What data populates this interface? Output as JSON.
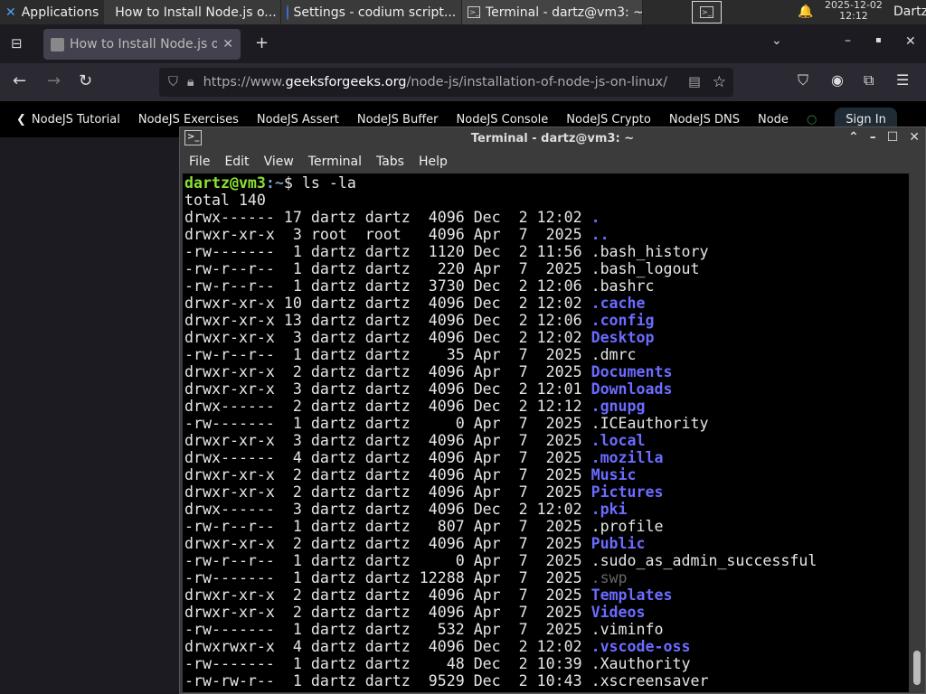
{
  "taskbar": {
    "apps": "Applications",
    "tasks": [
      "How to Install Node.js o...",
      "Settings - codium script...",
      "Terminal - dartz@vm3: ~"
    ],
    "date": "2025-12-02",
    "time": "12:12",
    "user": "Dartz"
  },
  "browser": {
    "tab_title": "How to Install Node.js or",
    "url_prefix": "https://www.",
    "url_domain": "geeksforgeeks.org",
    "url_path": "/node-js/installation-of-node-js-on-linux/",
    "bookmarks": [
      "NodeJS Tutorial",
      "NodeJS Exercises",
      "NodeJS Assert",
      "NodeJS Buffer",
      "NodeJS Console",
      "NodeJS Crypto",
      "NodeJS DNS",
      "Node"
    ],
    "signin": "Sign In"
  },
  "terminal": {
    "title": "Terminal - dartz@vm3: ~",
    "menu": [
      "File",
      "Edit",
      "View",
      "Terminal",
      "Tabs",
      "Help"
    ],
    "prompt_user": "dartz@vm3",
    "prompt_path": ":~",
    "command": "$ ls -la",
    "total": "total 140",
    "rows": [
      [
        "drwx------ 17 dartz dartz  4096 Dec  2 12:02 ",
        ".",
        "dir"
      ],
      [
        "drwxr-xr-x  3 root  root   4096 Apr  7  2025 ",
        "..",
        "dir"
      ],
      [
        "-rw-------  1 dartz dartz  1120 Dec  2 11:56 ",
        ".bash_history",
        ""
      ],
      [
        "-rw-r--r--  1 dartz dartz   220 Apr  7  2025 ",
        ".bash_logout",
        ""
      ],
      [
        "-rw-r--r--  1 dartz dartz  3730 Dec  2 12:06 ",
        ".bashrc",
        ""
      ],
      [
        "drwxr-xr-x 10 dartz dartz  4096 Dec  2 12:02 ",
        ".cache",
        "dir"
      ],
      [
        "drwxr-xr-x 13 dartz dartz  4096 Dec  2 12:06 ",
        ".config",
        "dir"
      ],
      [
        "drwxr-xr-x  3 dartz dartz  4096 Dec  2 12:02 ",
        "Desktop",
        "dir"
      ],
      [
        "-rw-r--r--  1 dartz dartz    35 Apr  7  2025 ",
        ".dmrc",
        ""
      ],
      [
        "drwxr-xr-x  2 dartz dartz  4096 Apr  7  2025 ",
        "Documents",
        "dir"
      ],
      [
        "drwxr-xr-x  3 dartz dartz  4096 Dec  2 12:01 ",
        "Downloads",
        "dir"
      ],
      [
        "drwx------  2 dartz dartz  4096 Dec  2 12:12 ",
        ".gnupg",
        "dir"
      ],
      [
        "-rw-------  1 dartz dartz     0 Apr  7  2025 ",
        ".ICEauthority",
        ""
      ],
      [
        "drwxr-xr-x  3 dartz dartz  4096 Apr  7  2025 ",
        ".local",
        "dir"
      ],
      [
        "drwx------  4 dartz dartz  4096 Apr  7  2025 ",
        ".mozilla",
        "dir"
      ],
      [
        "drwxr-xr-x  2 dartz dartz  4096 Apr  7  2025 ",
        "Music",
        "dir"
      ],
      [
        "drwxr-xr-x  2 dartz dartz  4096 Apr  7  2025 ",
        "Pictures",
        "dir"
      ],
      [
        "drwx------  3 dartz dartz  4096 Dec  2 12:02 ",
        ".pki",
        "dir"
      ],
      [
        "-rw-r--r--  1 dartz dartz   807 Apr  7  2025 ",
        ".profile",
        ""
      ],
      [
        "drwxr-xr-x  2 dartz dartz  4096 Apr  7  2025 ",
        "Public",
        "dir"
      ],
      [
        "-rw-r--r--  1 dartz dartz     0 Apr  7  2025 ",
        ".sudo_as_admin_successful",
        ""
      ],
      [
        "-rw-------  1 dartz dartz 12288 Apr  7  2025 ",
        ".swp",
        "dim"
      ],
      [
        "drwxr-xr-x  2 dartz dartz  4096 Apr  7  2025 ",
        "Templates",
        "dir"
      ],
      [
        "drwxr-xr-x  2 dartz dartz  4096 Apr  7  2025 ",
        "Videos",
        "dir"
      ],
      [
        "-rw-------  1 dartz dartz   532 Apr  7  2025 ",
        ".viminfo",
        ""
      ],
      [
        "drwxrwxr-x  4 dartz dartz  4096 Dec  2 12:02 ",
        ".vscode-oss",
        "dir"
      ],
      [
        "-rw-------  1 dartz dartz    48 Dec  2 10:39 ",
        ".Xauthority",
        ""
      ],
      [
        "-rw-rw-r--  1 dartz dartz  9529 Dec  2 10:43 ",
        ".xscreensaver",
        ""
      ]
    ]
  },
  "colors": {
    "prompt": "#8ae234",
    "path": "#729fcf",
    "directory": "#6b6bff",
    "terminal_bg": "#000000"
  }
}
